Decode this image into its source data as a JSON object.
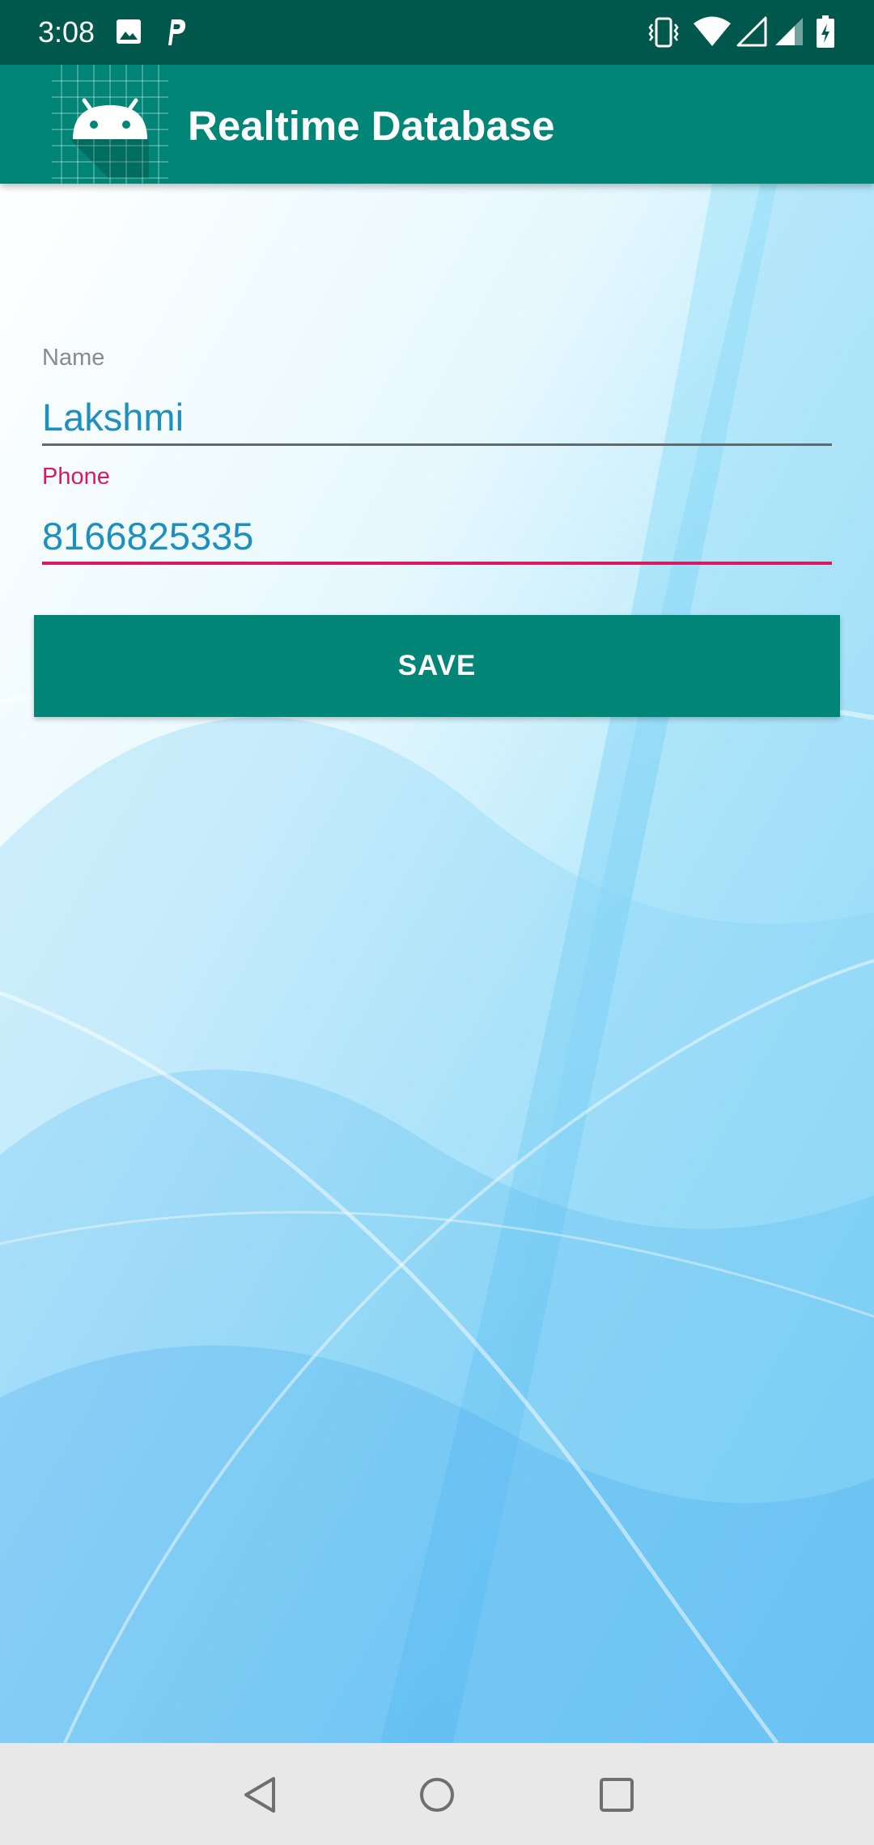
{
  "status_bar": {
    "time": "3:08",
    "left_icons": [
      "image-icon",
      "parking-icon"
    ],
    "right_icons": [
      "vibrate-icon",
      "wifi-icon",
      "signal-empty-icon",
      "signal-icon",
      "battery-charging-icon"
    ]
  },
  "app_bar": {
    "title": "Realtime Database",
    "logo_icon": "android-icon"
  },
  "form": {
    "name_label": "Name",
    "name_value": "Lakshmi",
    "phone_label": "Phone",
    "phone_value": "8166825335",
    "save_label": "SAVE"
  },
  "nav_bar": {
    "buttons": [
      "back-icon",
      "home-icon",
      "recents-icon"
    ]
  },
  "colors": {
    "status_bar": "#00574b",
    "app_bar": "#008577",
    "accent": "#d81b60",
    "input_text": "#1e90c0",
    "nav_bar": "#e8e8e8"
  }
}
